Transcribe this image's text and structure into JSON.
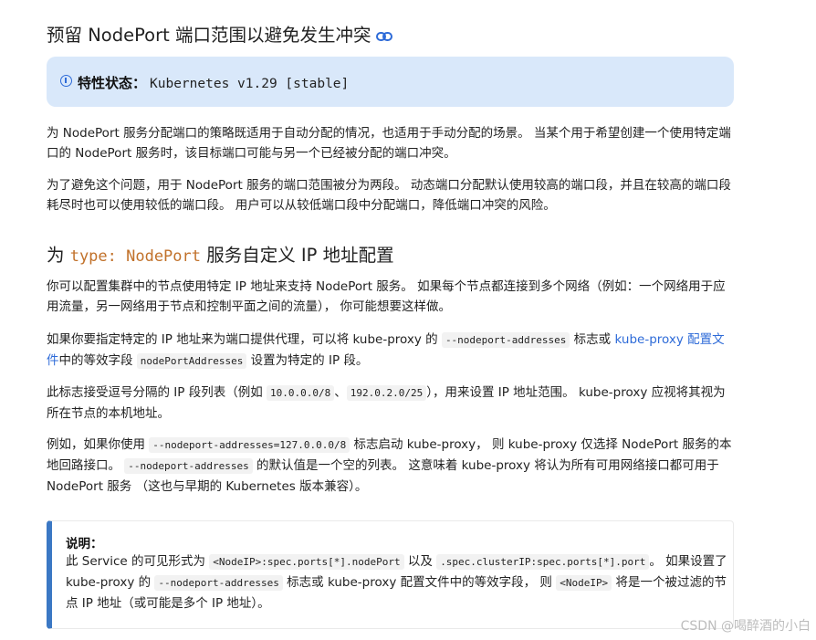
{
  "section1": {
    "heading": "预留 NodePort 端口范围以避免发生冲突",
    "link_icon": "link-icon"
  },
  "feature_state": {
    "icon": "info-circle-icon",
    "label": "特性状态：",
    "value": "Kubernetes v1.29 [stable]",
    "colors": {
      "background": "#d9e8fa",
      "icon": "#2e6bd8"
    }
  },
  "para1": {
    "text": "为 NodePort 服务分配端口的策略既适用于自动分配的情况，也适用于手动分配的场景。 当某个用于希望创建一个使用特定端口的 NodePort 服务时，该目标端口可能与另一个已经被分配的端口冲突。"
  },
  "para2": {
    "text": "为了避免这个问题，用于 NodePort 服务的端口范围被分为两段。 动态端口分配默认使用较高的端口段，并且在较高的端口段耗尽时也可以使用较低的端口段。 用户可以从较低端口段中分配端口，降低端口冲突的风险。"
  },
  "section2": {
    "prefix": "为 ",
    "code": "type: NodePort",
    "suffix": " 服务自定义 IP 地址配置"
  },
  "para3": {
    "text": "你可以配置集群中的节点使用特定 IP 地址来支持 NodePort 服务。 如果每个节点都连接到多个网络（例如：一个网络用于应用流量，另一网络用于节点和控制平面之间的流量）， 你可能想要这样做。"
  },
  "para4": {
    "t1": "如果你要指定特定的 IP 地址来为端口提供代理，可以将 kube-proxy 的 ",
    "code1": "--nodeport-addresses",
    "t2": " 标志或 ",
    "link": "kube-proxy 配置文件",
    "t3": "中的等效字段 ",
    "code2": "nodePortAddresses",
    "t4": " 设置为特定的 IP 段。"
  },
  "para5": {
    "t1": "此标志接受逗号分隔的 IP 段列表（例如 ",
    "code1": "10.0.0.0/8",
    "t2": "、",
    "code2": "192.0.2.0/25",
    "t3": "），用来设置 IP 地址范围。 kube-proxy 应视将其视为所在节点的本机地址。"
  },
  "para6": {
    "t1": "例如，如果你使用 ",
    "code1": "--nodeport-addresses=127.0.0.0/8",
    "t2": " 标志启动 kube-proxy， 则 kube-proxy 仅选择 NodePort 服务的本地回路接口。 ",
    "code2": "--nodeport-addresses",
    "t3": " 的默认值是一个空的列表。 这意味着 kube-proxy 将认为所有可用网络接口都可用于 NodePort 服务 （这也与早期的 Kubernetes 版本兼容）。"
  },
  "note": {
    "title": "说明：",
    "t1": "此 Service 的可见形式为 ",
    "code1": "<NodeIP>:spec.ports[*].nodePort",
    "t2": " 以及 ",
    "code2": ".spec.clusterIP:spec.ports[*].port",
    "t3": "。 如果设置了 kube-proxy 的 ",
    "code3": "--nodeport-addresses",
    "t4": " 标志或 kube-proxy 配置文件中的等效字段， 则 ",
    "code4": "<NodeIP>",
    "t5": " 将是一个被过滤的节点 IP 地址（或可能是多个 IP 地址）。",
    "accent_color": "#3b78c4"
  },
  "watermark": {
    "text": "CSDN @喝醉酒的小白"
  }
}
